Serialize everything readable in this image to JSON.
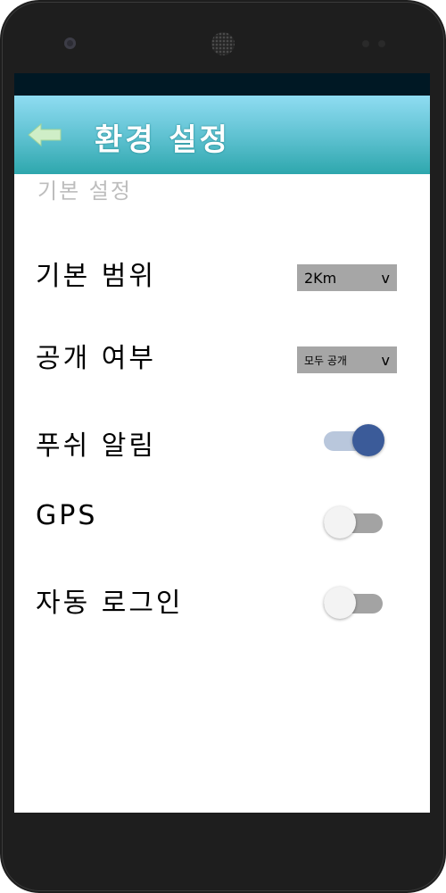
{
  "appbar": {
    "title": "환경 설정"
  },
  "section": {
    "title": "기본 설정"
  },
  "settings": {
    "range": {
      "label": "기본 범위",
      "value": "2Km",
      "arrow": "v"
    },
    "visibility": {
      "label": "공개 여부",
      "value": "모두 공개",
      "arrow": "v"
    },
    "push": {
      "label": "푸쉬 알림",
      "on": true
    },
    "gps": {
      "label": "GPS",
      "on": false
    },
    "autologin": {
      "label": "자동 로그인",
      "on": false
    }
  },
  "colors": {
    "appbar_top": "#8fdcf2",
    "appbar_bottom": "#2ea7ad",
    "toggle_on": "#3b5b99",
    "dropdown_bg": "#a6a6a6"
  }
}
